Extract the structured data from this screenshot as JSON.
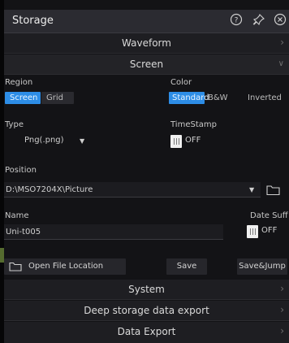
{
  "window": {
    "title": "Storage"
  },
  "titlebar_icons": [
    "help-icon",
    "pin-icon",
    "close-icon"
  ],
  "sections": {
    "waveform": "Waveform",
    "screen": "Screen",
    "system": "System",
    "deep": "Deep storage data export",
    "data_export": "Data Export"
  },
  "region": {
    "label": "Region",
    "options": [
      "Screen",
      "Grid"
    ],
    "selected": "Screen"
  },
  "color": {
    "label": "Color",
    "options": [
      "Standard",
      "B&W",
      "Inverted"
    ],
    "selected": "Standard"
  },
  "type": {
    "label": "Type",
    "value": "Png(.png)"
  },
  "timestamp": {
    "label": "TimeStamp",
    "value": "OFF"
  },
  "position": {
    "label": "Position",
    "value": "D:\\MSO7204X\\Picture"
  },
  "name": {
    "label": "Name",
    "value": "Uni-t005"
  },
  "date_suffix": {
    "label": "Date Suff",
    "value": "OFF"
  },
  "actions": {
    "open_location": "Open File Location",
    "save": "Save",
    "save_jump": "Save&Jump"
  },
  "colors": {
    "accent": "#2d8de6",
    "background": "#131316",
    "header": "#2b2b31"
  }
}
